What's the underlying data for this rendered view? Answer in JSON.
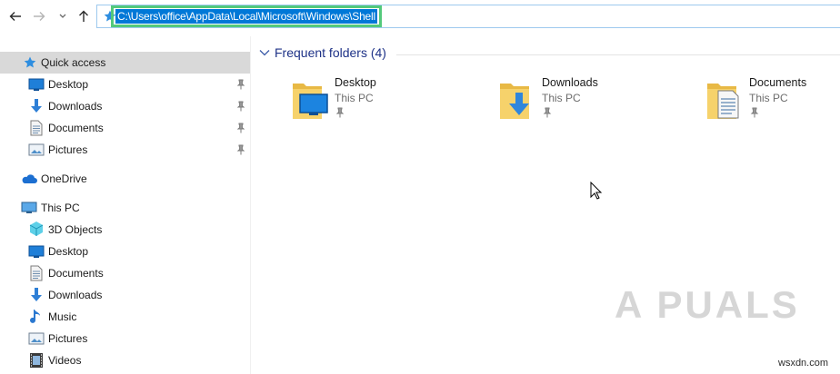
{
  "address_bar": {
    "path": "C:\\Users\\office\\AppData\\Local\\Microsoft\\Windows\\Shell"
  },
  "sidebar": {
    "quick_access": {
      "label": "Quick access",
      "items": [
        {
          "label": "Desktop",
          "icon": "desktop-icon"
        },
        {
          "label": "Downloads",
          "icon": "downloads-icon"
        },
        {
          "label": "Documents",
          "icon": "documents-icon"
        },
        {
          "label": "Pictures",
          "icon": "pictures-icon"
        }
      ]
    },
    "onedrive": {
      "label": "OneDrive"
    },
    "this_pc": {
      "label": "This PC",
      "items": [
        {
          "label": "3D Objects",
          "icon": "3d-objects-icon"
        },
        {
          "label": "Desktop",
          "icon": "desktop-icon"
        },
        {
          "label": "Documents",
          "icon": "documents-icon"
        },
        {
          "label": "Downloads",
          "icon": "downloads-icon"
        },
        {
          "label": "Music",
          "icon": "music-icon"
        },
        {
          "label": "Pictures",
          "icon": "pictures-icon"
        },
        {
          "label": "Videos",
          "icon": "videos-icon"
        }
      ]
    }
  },
  "main": {
    "group_title": "Frequent folders (4)",
    "folders": [
      {
        "name": "Desktop",
        "location": "This PC"
      },
      {
        "name": "Downloads",
        "location": "This PC"
      },
      {
        "name": "Documents",
        "location": "This PC"
      }
    ]
  },
  "watermark": {
    "text": "A PUALS",
    "site": "wsxdn.com"
  },
  "colors": {
    "selection_blue": "#0078d7",
    "highlight_green": "#53c97b",
    "group_title_blue": "#1e3287",
    "selected_row": "#d9d9d9"
  }
}
